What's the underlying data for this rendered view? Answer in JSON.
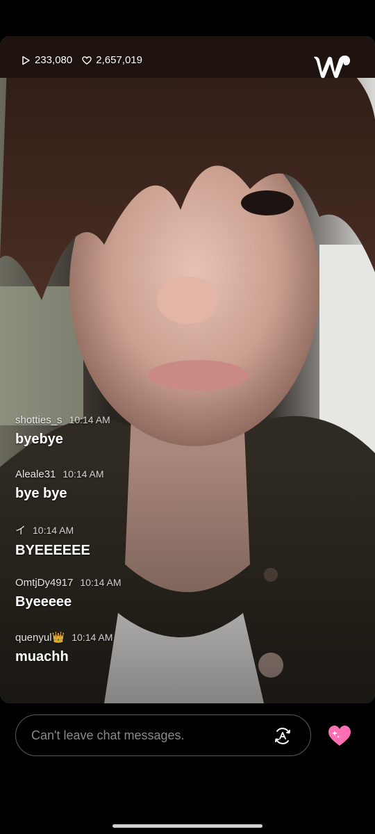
{
  "stats": {
    "views": "233,080",
    "likes": "2,657,019",
    "views_icon": "play-icon",
    "likes_icon": "heart-outline-icon"
  },
  "logo": {
    "icon": "weverse-logo"
  },
  "chat": {
    "messages": [
      {
        "user": "shotties_s",
        "time": "10:14 AM",
        "text": "byebye"
      },
      {
        "user": "Aleale31",
        "time": "10:14 AM",
        "text": "bye bye"
      },
      {
        "user": "イ",
        "time": "10:14 AM",
        "text": "BYEEEEEE"
      },
      {
        "user": "OmtjDy4917",
        "time": "10:14 AM",
        "text": "Byeeeee"
      },
      {
        "user": "quenyul👑",
        "time": "10:14 AM",
        "text": "muachh"
      }
    ]
  },
  "input": {
    "placeholder": "Can't leave chat messages.",
    "translate_icon": "translate-icon"
  },
  "heart_button": {
    "icon": "sparkle-heart-icon",
    "color": "#ff6fb4"
  }
}
